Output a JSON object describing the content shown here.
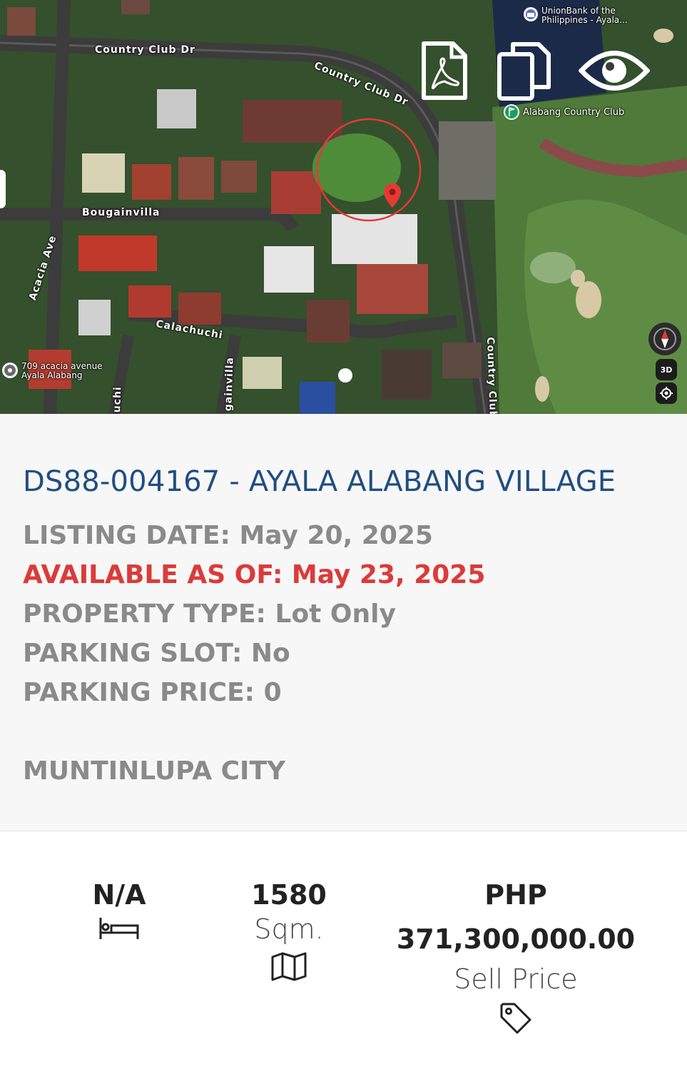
{
  "map": {
    "streets": [
      "Country Club Dr",
      "Country Club Dr",
      "Bougainvilla",
      "Acacia Ave",
      "Calachuchi",
      "gainvilla",
      "uchi",
      "Country Club"
    ],
    "poi_bank": "UnionBank of the Philippines - Ayala...",
    "poi_club": "Alabang Country Club",
    "poi_location": "709 acacia avenue Ayala Alabang",
    "view_3d_label": "3D",
    "icons": [
      "pdf-icon",
      "copy-icon",
      "eye-icon",
      "compass-icon",
      "locate-icon",
      "map-pin-icon"
    ]
  },
  "listing": {
    "title": "DS88-004167 - AYALA ALABANG VILLAGE",
    "listing_date_label": "LISTING DATE:",
    "listing_date": "May 20, 2025",
    "available_label": "AVAILABLE AS OF:",
    "available_date": "May 23, 2025",
    "property_type_label": "PROPERTY TYPE:",
    "property_type": "Lot Only",
    "parking_slot_label": "PARKING SLOT:",
    "parking_slot": "No",
    "parking_price_label": "PARKING PRICE:",
    "parking_price": "0",
    "city": "MUNTINLUPA CITY"
  },
  "stats": {
    "bedrooms": "N/A",
    "area_value": "1580",
    "area_unit": "Sqm.",
    "currency": "PHP",
    "price": "371,300,000.00",
    "price_label": "Sell Price"
  },
  "colors": {
    "title": "#1f4e82",
    "label_gray": "#8a8a8a",
    "available_red": "#dc3a3a",
    "pin_red": "#e53935"
  }
}
